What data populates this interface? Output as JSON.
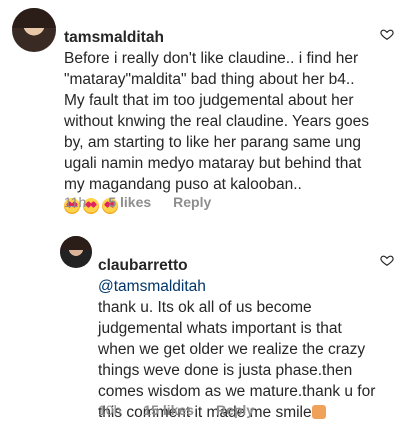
{
  "comments": [
    {
      "username": "tamsmalditah",
      "text": "Before i really don't like claudine.. i find her \"mataray\"maldita\" bad thing about her b4.. My fault that im too judgemental about her without knwing the real claudine. Years goes by, am starting to like her parang same ung ugali namin medyo mataray but behind that my magandang puso at kalooban..",
      "emoji_icons": [
        "heart-eyes-face-icon",
        "heart-eyes-face-icon",
        "heart-eyes-face-icon"
      ],
      "time": "11h",
      "likes": "5 likes",
      "reply_label": "Reply"
    },
    {
      "username": "claubarretto",
      "mention": "@tamsmalditah",
      "text": "thank u. Its ok all of us become judgemental whats important is that when we get older we realize the crazy things weve done is justa phase.then comes wisdom as we mature.thank u for this comment it made me smile",
      "emoji_icon": "person-bowing-icon",
      "time": "10h",
      "likes": "15 likes",
      "reply_label": "Reply"
    }
  ],
  "colors": {
    "text": "#262626",
    "meta": "#8e8e8e",
    "mention": "#003569",
    "background": "#ffffff"
  }
}
